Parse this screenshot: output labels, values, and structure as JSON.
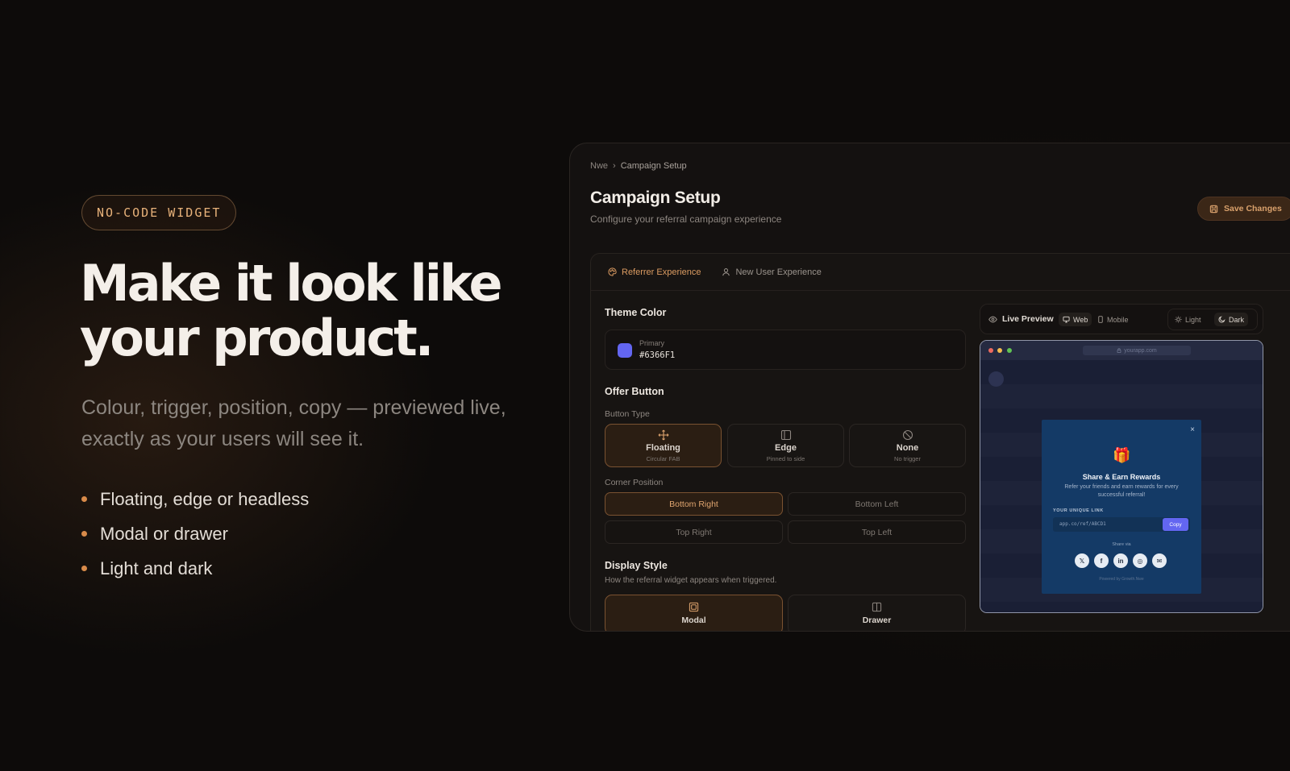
{
  "hero": {
    "badge": "NO-CODE WIDGET",
    "title_line1": "Make it look like",
    "title_line2": "your product.",
    "subtitle": "Colour, trigger, position, copy — previewed live, exactly as your users will see it.",
    "bullets": [
      "Floating, edge or headless",
      "Modal or drawer",
      "Light and dark"
    ]
  },
  "app": {
    "breadcrumb": [
      "Nwe",
      "Campaign Setup"
    ],
    "breadcrumb_sep": "›",
    "page_title": "Campaign Setup",
    "page_desc": "Configure your referral campaign experience",
    "save_label": "Save Changes",
    "tabs": [
      {
        "label": "Referrer Experience",
        "icon": "palette-icon",
        "active": true
      },
      {
        "label": "New User Experience",
        "icon": "user-icon",
        "active": false
      }
    ],
    "theme": {
      "title": "Theme Color",
      "caption": "Primary",
      "hex": "#6366F1"
    },
    "offer": {
      "title": "Offer Button",
      "type_label": "Button Type",
      "types": [
        {
          "title": "Floating",
          "sub": "Circular FAB",
          "icon": "move-icon",
          "active": true
        },
        {
          "title": "Edge",
          "sub": "Pinned to side",
          "icon": "sidebar-icon",
          "active": false
        },
        {
          "title": "None",
          "sub": "No trigger",
          "icon": "ban-icon",
          "active": false
        }
      ],
      "corner_label": "Corner Position",
      "corners": [
        {
          "label": "Bottom Right",
          "active": true
        },
        {
          "label": "Bottom Left",
          "active": false
        },
        {
          "label": "Top Right",
          "active": false
        },
        {
          "label": "Top Left",
          "active": false
        }
      ]
    },
    "display": {
      "title": "Display Style",
      "desc": "How the referral widget appears when triggered.",
      "options": [
        {
          "label": "Modal",
          "icon": "modal-icon",
          "active": true
        },
        {
          "label": "Drawer",
          "icon": "drawer-icon",
          "active": false
        }
      ]
    },
    "preview": {
      "title": "Live Preview",
      "web": "Web",
      "mobile": "Mobile",
      "light": "Light",
      "dark": "Dark",
      "url": "yourapp.com",
      "modal": {
        "title": "Share & Earn Rewards",
        "desc": "Refer your friends and earn rewards for every successful referral!",
        "link_label": "YOUR UNIQUE LINK",
        "link": "app.co/ref/ABCD1",
        "copy": "Copy",
        "share_via": "Share via",
        "close": "×",
        "gift": "🎁",
        "socials": [
          "𝕏",
          "f",
          "in",
          "◎",
          "✉"
        ],
        "powered": "Powered by Growth.Nwe"
      }
    }
  },
  "colors": {
    "accent": "#DC9C62",
    "primary": "#6366F1",
    "background": "#0D0B0A"
  }
}
